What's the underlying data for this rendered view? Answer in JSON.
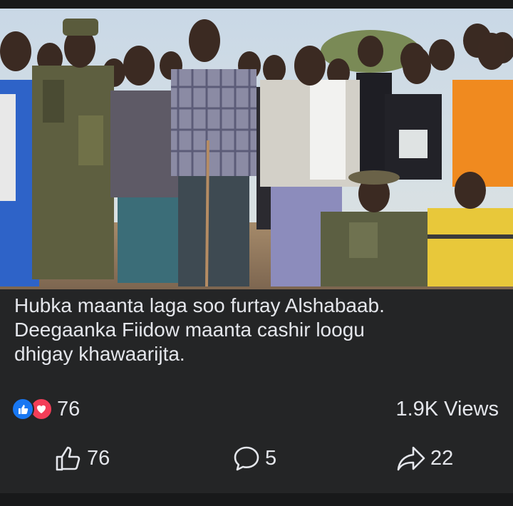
{
  "post": {
    "caption_lines": [
      "Hubka maanta laga soo furtay Alshabaab.",
      "Deegaanka Fiidow maanta cashir loogu",
      "dhigay khawaarijta."
    ]
  },
  "stats": {
    "reaction_icons": [
      "like-icon",
      "love-icon"
    ],
    "reaction_count": "76",
    "views": "1.9K Views"
  },
  "actions": {
    "like_count": "76",
    "comment_count": "5",
    "share_count": "22"
  },
  "colors": {
    "background": "#242526",
    "like_blue": "#1877f2",
    "love_red": "#f33e58",
    "text": "#e4e6eb"
  }
}
